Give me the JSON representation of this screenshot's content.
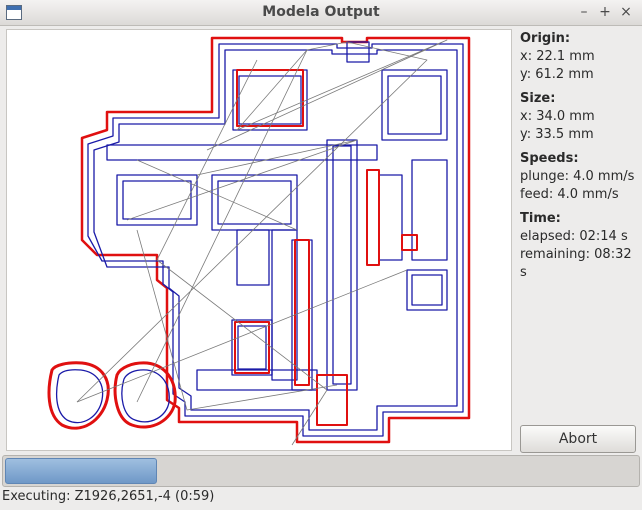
{
  "window": {
    "title": "Modela Output"
  },
  "controls": {
    "minimize": "–",
    "maximize": "+",
    "close": "×"
  },
  "info": {
    "origin_label": "Origin:",
    "origin_x": "x: 22.1 mm",
    "origin_y": "y: 61.2 mm",
    "size_label": "Size:",
    "size_x": "x: 34.0 mm",
    "size_y": "y: 33.5 mm",
    "speeds_label": "Speeds:",
    "plunge": "plunge: 4.0 mm/s",
    "feed": "feed: 4.0 mm/s",
    "time_label": "Time:",
    "elapsed": "elapsed: 02:14 s",
    "remaining": "remaining: 08:32 s"
  },
  "abort_label": "Abort",
  "progress": {
    "fraction": 0.24
  },
  "status": "Executing: Z1926,2651,-4 (0:59)",
  "colors": {
    "outline": "#e01010",
    "trace": "#1a1aa8",
    "travel": "#7a7a7a"
  }
}
